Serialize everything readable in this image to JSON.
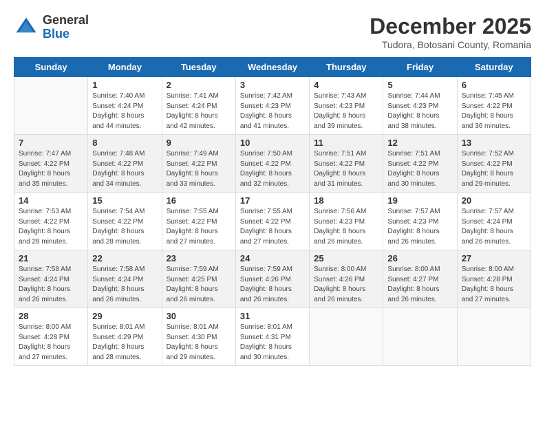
{
  "logo": {
    "general": "General",
    "blue": "Blue"
  },
  "title": "December 2025",
  "subtitle": "Tudora, Botosani County, Romania",
  "days_of_week": [
    "Sunday",
    "Monday",
    "Tuesday",
    "Wednesday",
    "Thursday",
    "Friday",
    "Saturday"
  ],
  "weeks": [
    [
      {
        "day": "",
        "sunrise": "",
        "sunset": "",
        "daylight": ""
      },
      {
        "day": "1",
        "sunrise": "Sunrise: 7:40 AM",
        "sunset": "Sunset: 4:24 PM",
        "daylight": "Daylight: 8 hours and 44 minutes."
      },
      {
        "day": "2",
        "sunrise": "Sunrise: 7:41 AM",
        "sunset": "Sunset: 4:24 PM",
        "daylight": "Daylight: 8 hours and 42 minutes."
      },
      {
        "day": "3",
        "sunrise": "Sunrise: 7:42 AM",
        "sunset": "Sunset: 4:23 PM",
        "daylight": "Daylight: 8 hours and 41 minutes."
      },
      {
        "day": "4",
        "sunrise": "Sunrise: 7:43 AM",
        "sunset": "Sunset: 4:23 PM",
        "daylight": "Daylight: 8 hours and 39 minutes."
      },
      {
        "day": "5",
        "sunrise": "Sunrise: 7:44 AM",
        "sunset": "Sunset: 4:23 PM",
        "daylight": "Daylight: 8 hours and 38 minutes."
      },
      {
        "day": "6",
        "sunrise": "Sunrise: 7:45 AM",
        "sunset": "Sunset: 4:22 PM",
        "daylight": "Daylight: 8 hours and 36 minutes."
      }
    ],
    [
      {
        "day": "7",
        "sunrise": "Sunrise: 7:47 AM",
        "sunset": "Sunset: 4:22 PM",
        "daylight": "Daylight: 8 hours and 35 minutes."
      },
      {
        "day": "8",
        "sunrise": "Sunrise: 7:48 AM",
        "sunset": "Sunset: 4:22 PM",
        "daylight": "Daylight: 8 hours and 34 minutes."
      },
      {
        "day": "9",
        "sunrise": "Sunrise: 7:49 AM",
        "sunset": "Sunset: 4:22 PM",
        "daylight": "Daylight: 8 hours and 33 minutes."
      },
      {
        "day": "10",
        "sunrise": "Sunrise: 7:50 AM",
        "sunset": "Sunset: 4:22 PM",
        "daylight": "Daylight: 8 hours and 32 minutes."
      },
      {
        "day": "11",
        "sunrise": "Sunrise: 7:51 AM",
        "sunset": "Sunset: 4:22 PM",
        "daylight": "Daylight: 8 hours and 31 minutes."
      },
      {
        "day": "12",
        "sunrise": "Sunrise: 7:51 AM",
        "sunset": "Sunset: 4:22 PM",
        "daylight": "Daylight: 8 hours and 30 minutes."
      },
      {
        "day": "13",
        "sunrise": "Sunrise: 7:52 AM",
        "sunset": "Sunset: 4:22 PM",
        "daylight": "Daylight: 8 hours and 29 minutes."
      }
    ],
    [
      {
        "day": "14",
        "sunrise": "Sunrise: 7:53 AM",
        "sunset": "Sunset: 4:22 PM",
        "daylight": "Daylight: 8 hours and 28 minutes."
      },
      {
        "day": "15",
        "sunrise": "Sunrise: 7:54 AM",
        "sunset": "Sunset: 4:22 PM",
        "daylight": "Daylight: 8 hours and 28 minutes."
      },
      {
        "day": "16",
        "sunrise": "Sunrise: 7:55 AM",
        "sunset": "Sunset: 4:22 PM",
        "daylight": "Daylight: 8 hours and 27 minutes."
      },
      {
        "day": "17",
        "sunrise": "Sunrise: 7:55 AM",
        "sunset": "Sunset: 4:22 PM",
        "daylight": "Daylight: 8 hours and 27 minutes."
      },
      {
        "day": "18",
        "sunrise": "Sunrise: 7:56 AM",
        "sunset": "Sunset: 4:23 PM",
        "daylight": "Daylight: 8 hours and 26 minutes."
      },
      {
        "day": "19",
        "sunrise": "Sunrise: 7:57 AM",
        "sunset": "Sunset: 4:23 PM",
        "daylight": "Daylight: 8 hours and 26 minutes."
      },
      {
        "day": "20",
        "sunrise": "Sunrise: 7:57 AM",
        "sunset": "Sunset: 4:24 PM",
        "daylight": "Daylight: 8 hours and 26 minutes."
      }
    ],
    [
      {
        "day": "21",
        "sunrise": "Sunrise: 7:58 AM",
        "sunset": "Sunset: 4:24 PM",
        "daylight": "Daylight: 8 hours and 26 minutes."
      },
      {
        "day": "22",
        "sunrise": "Sunrise: 7:58 AM",
        "sunset": "Sunset: 4:24 PM",
        "daylight": "Daylight: 8 hours and 26 minutes."
      },
      {
        "day": "23",
        "sunrise": "Sunrise: 7:59 AM",
        "sunset": "Sunset: 4:25 PM",
        "daylight": "Daylight: 8 hours and 26 minutes."
      },
      {
        "day": "24",
        "sunrise": "Sunrise: 7:59 AM",
        "sunset": "Sunset: 4:26 PM",
        "daylight": "Daylight: 8 hours and 26 minutes."
      },
      {
        "day": "25",
        "sunrise": "Sunrise: 8:00 AM",
        "sunset": "Sunset: 4:26 PM",
        "daylight": "Daylight: 8 hours and 26 minutes."
      },
      {
        "day": "26",
        "sunrise": "Sunrise: 8:00 AM",
        "sunset": "Sunset: 4:27 PM",
        "daylight": "Daylight: 8 hours and 26 minutes."
      },
      {
        "day": "27",
        "sunrise": "Sunrise: 8:00 AM",
        "sunset": "Sunset: 4:28 PM",
        "daylight": "Daylight: 8 hours and 27 minutes."
      }
    ],
    [
      {
        "day": "28",
        "sunrise": "Sunrise: 8:00 AM",
        "sunset": "Sunset: 4:28 PM",
        "daylight": "Daylight: 8 hours and 27 minutes."
      },
      {
        "day": "29",
        "sunrise": "Sunrise: 8:01 AM",
        "sunset": "Sunset: 4:29 PM",
        "daylight": "Daylight: 8 hours and 28 minutes."
      },
      {
        "day": "30",
        "sunrise": "Sunrise: 8:01 AM",
        "sunset": "Sunset: 4:30 PM",
        "daylight": "Daylight: 8 hours and 29 minutes."
      },
      {
        "day": "31",
        "sunrise": "Sunrise: 8:01 AM",
        "sunset": "Sunset: 4:31 PM",
        "daylight": "Daylight: 8 hours and 30 minutes."
      },
      {
        "day": "",
        "sunrise": "",
        "sunset": "",
        "daylight": ""
      },
      {
        "day": "",
        "sunrise": "",
        "sunset": "",
        "daylight": ""
      },
      {
        "day": "",
        "sunrise": "",
        "sunset": "",
        "daylight": ""
      }
    ]
  ]
}
